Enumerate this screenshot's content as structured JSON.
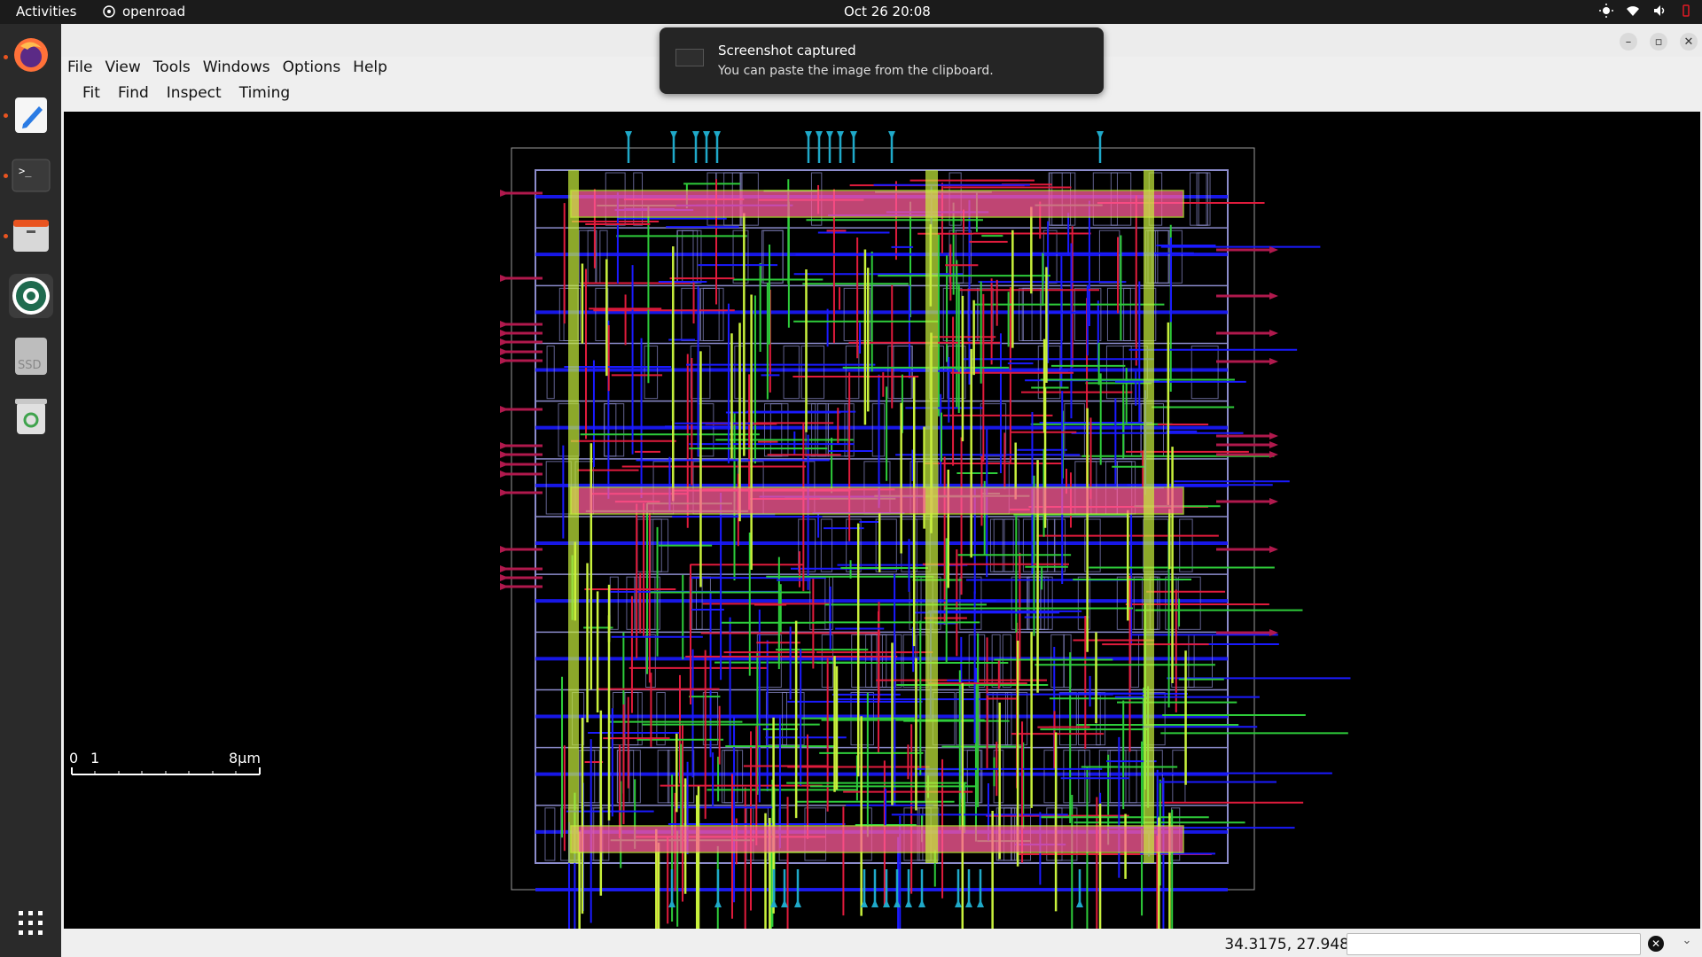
{
  "topbar": {
    "activities": "Activities",
    "app_name": "openroad",
    "clock": "Oct 26  20:08",
    "tray_icons": [
      "brightness-icon",
      "wifi-icon",
      "volume-icon",
      "power-icon"
    ]
  },
  "dock": {
    "items": [
      {
        "name": "firefox-icon",
        "running": true
      },
      {
        "name": "text-editor-icon",
        "running": true
      },
      {
        "name": "terminal-icon",
        "running": true
      },
      {
        "name": "files-icon",
        "running": true
      },
      {
        "name": "openroad-icon",
        "running": true
      },
      {
        "name": "ssd-drive-icon",
        "label": "SSD",
        "running": false
      },
      {
        "name": "trash-icon",
        "running": false
      }
    ],
    "apps_grid": "show-apps-icon"
  },
  "window": {
    "menu": [
      "File",
      "View",
      "Tools",
      "Windows",
      "Options",
      "Help"
    ],
    "toolbar": [
      "Fit",
      "Find",
      "Inspect",
      "Timing"
    ],
    "scale_bar": {
      "zero": "0",
      "one": "1",
      "end": "8μm"
    },
    "status": {
      "coords": "34.3175, 27.948",
      "input_value": ""
    }
  },
  "toast": {
    "title": "Screenshot captured",
    "body": "You can paste the image from the clipboard."
  },
  "colors": {
    "background": "#000000",
    "metal1": "#1a1aff",
    "metal2": "#e01b3c",
    "metal3": "#2ecc3a",
    "metal4": "#c8f03c",
    "power_strap": "#ff5c9a",
    "pin": "#1fa9c9",
    "io_pin": "#b0194d",
    "cell_outline": "#8c8ccc"
  }
}
